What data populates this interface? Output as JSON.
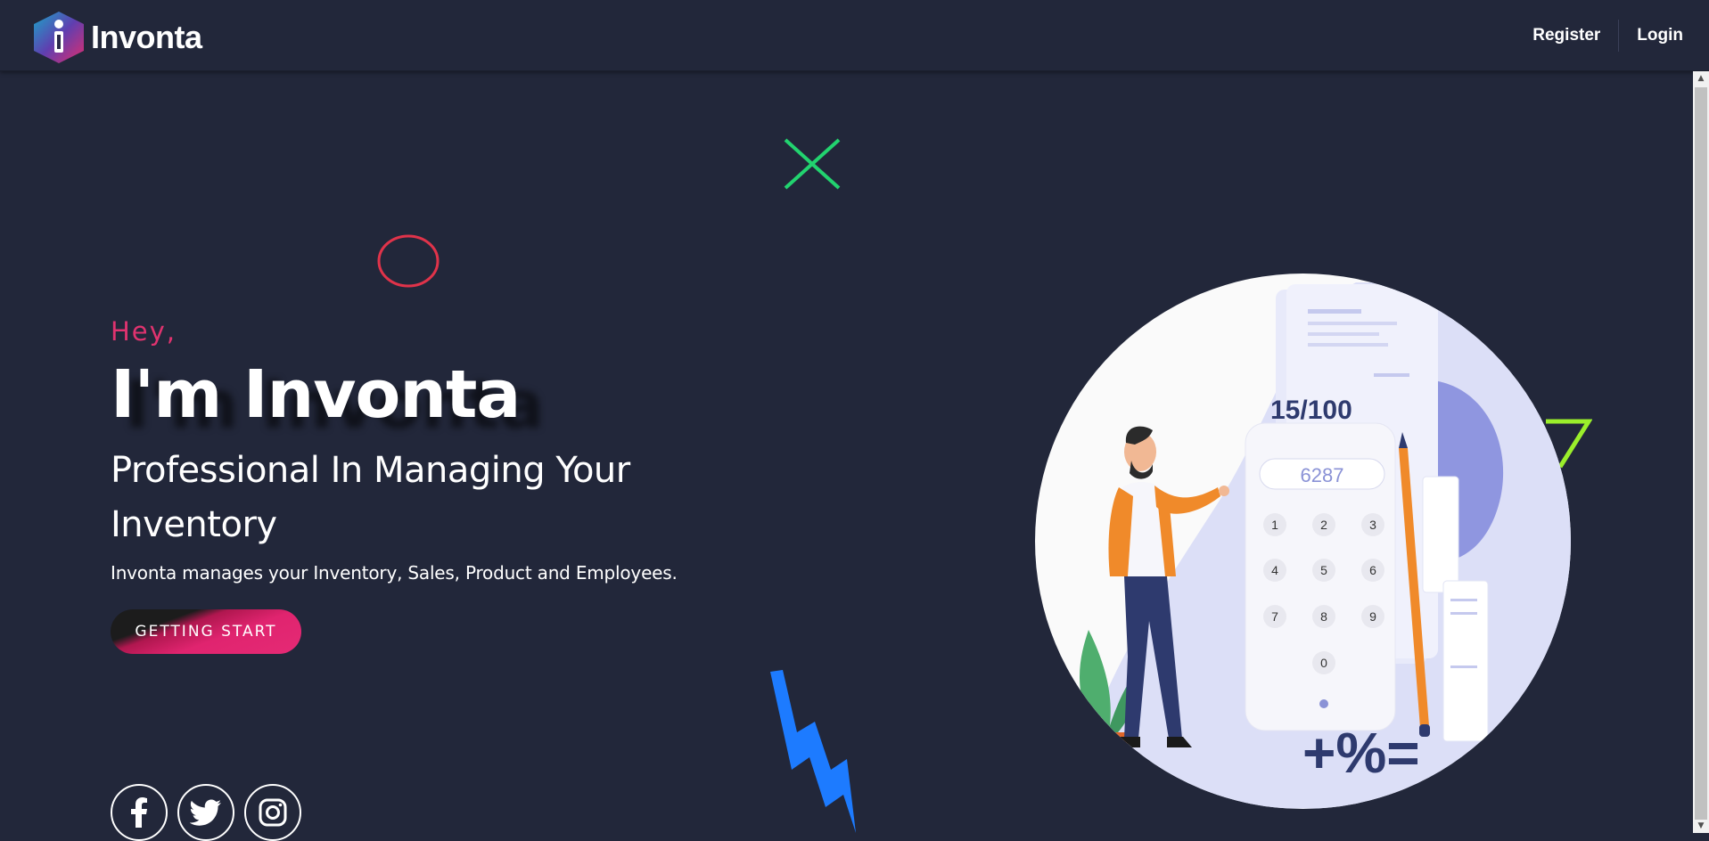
{
  "brand": {
    "name": "Invonta"
  },
  "nav": {
    "register": "Register",
    "login": "Login"
  },
  "hero": {
    "greeting": "Hey,",
    "title": "I'm Invonta",
    "subtitle": "Professional In Managing Your Inventory",
    "description": "Invonta manages your Inventory, Sales, Product and Employees.",
    "cta_label": "GETTING START"
  },
  "illustration": {
    "score": "15/100",
    "display": "6287",
    "keys": [
      "1",
      "2",
      "3",
      "4",
      "5",
      "6",
      "7",
      "8",
      "9",
      "0"
    ],
    "symbols": "+%="
  },
  "socials": [
    "facebook-icon",
    "twitter-icon",
    "instagram-icon"
  ],
  "colors": {
    "background": "#22273a",
    "accent_pink": "#e0336f",
    "accent_green": "#22d36f",
    "accent_blue": "#1d7bff",
    "accent_lime": "#9bee2b",
    "accent_red": "#e0334a"
  }
}
